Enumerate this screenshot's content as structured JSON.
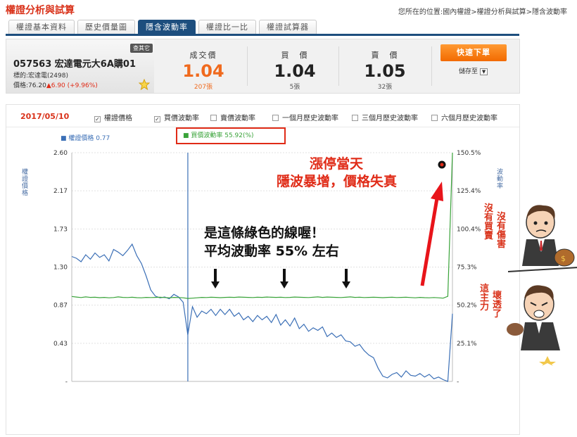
{
  "header": {
    "title": "權證分析與試算",
    "breadcrumb": "您所在的位置:國內權證>權證分析與試算>隱含波動率"
  },
  "tabs": [
    {
      "label": "權證基本資料",
      "active": false
    },
    {
      "label": "歷史價量圖",
      "active": false
    },
    {
      "label": "隱含波動率",
      "active": true
    },
    {
      "label": "權證比一比",
      "active": false
    },
    {
      "label": "權證試算器",
      "active": false
    }
  ],
  "quote": {
    "badge": "查其它",
    "code_name": "057563 宏達電元大6A購01",
    "underlying": "標的:宏達電(2498)",
    "price_prefix": "價格:76.20",
    "price_change": "▲6.90 (+9.96%)",
    "last": {
      "label": "成交價",
      "value": "1.04",
      "volume": "207張"
    },
    "bid": {
      "label": "買　價",
      "value": "1.04",
      "volume": "5張"
    },
    "ask": {
      "label": "賣　價",
      "value": "1.05",
      "volume": "32張"
    },
    "order_button": "快速下單",
    "save_label": "儲存至"
  },
  "toolbar": {
    "date": "2017/05/10",
    "options": [
      {
        "label": "權證價格",
        "checked": true
      },
      {
        "label": "買價波動率",
        "checked": true
      },
      {
        "label": "賣價波動率",
        "checked": false
      },
      {
        "label": "一個月歷史波動率",
        "checked": false
      },
      {
        "label": "三個月歷史波動率",
        "checked": false
      },
      {
        "label": "六個月歷史波動率",
        "checked": false
      }
    ]
  },
  "chart_labels": {
    "legend_price": "■ 權證價格 0.77",
    "legend_vol": "■ 買價波動率 55.92(%)",
    "y_left_title": "權證價格",
    "y_right_title": "波動率"
  },
  "annotations": {
    "spike_title": "漲停當天",
    "spike_sub": "隱波暴增，價格失真",
    "green_line_1": "是這條綠色的線喔！",
    "green_line_2": "平均波動率 55%  左右"
  },
  "cartoon": {
    "left_text_1": "沒有買賣",
    "right_text_1": "沒有傷害",
    "left_text_2": "這主力",
    "right_text_2": "壞透了"
  },
  "colors": {
    "brand_red": "#d9321a",
    "tab_active": "#1d4e7e",
    "price_line": "#3b6fb6",
    "vol_line": "#39a339",
    "last_price": "#f06a1e",
    "buy_button": "#f57d14"
  },
  "chart_data": {
    "type": "line",
    "y_left": {
      "ticks": [
        "2.60",
        "2.17",
        "1.73",
        "1.30",
        "0.87",
        "0.43",
        "-"
      ],
      "min": 0,
      "max": 2.6
    },
    "y_right": {
      "ticks": [
        "150.5%",
        "125.4%",
        "100.4%",
        "75.3%",
        "50.2%",
        "25.1%",
        "-"
      ],
      "min": 0,
      "max": 150.5
    },
    "series": [
      {
        "name": "權證價格",
        "axis": "left",
        "color": "#3b6fb6",
        "values": [
          1.42,
          1.4,
          1.36,
          1.44,
          1.39,
          1.46,
          1.41,
          1.44,
          1.37,
          1.5,
          1.47,
          1.43,
          1.49,
          1.56,
          1.43,
          1.34,
          1.2,
          1.04,
          0.97,
          0.95,
          0.96,
          0.94,
          0.99,
          0.96,
          0.9,
          0.53,
          0.85,
          0.73,
          0.8,
          0.77,
          0.82,
          0.75,
          0.82,
          0.76,
          0.82,
          0.74,
          0.78,
          0.7,
          0.74,
          0.68,
          0.75,
          0.7,
          0.74,
          0.67,
          0.76,
          0.64,
          0.7,
          0.63,
          0.72,
          0.6,
          0.65,
          0.57,
          0.61,
          0.58,
          0.62,
          0.51,
          0.55,
          0.5,
          0.53,
          0.46,
          0.45,
          0.4,
          0.42,
          0.35,
          0.3,
          0.27,
          0.15,
          0.06,
          0.04,
          0.08,
          0.1,
          0.05,
          0.12,
          0.07,
          0.06,
          0.09,
          0.05,
          0.08,
          0.03,
          0.05,
          0.02,
          0.0,
          0.77
        ]
      },
      {
        "name": "買價波動率",
        "axis": "right",
        "color": "#39a339",
        "values": [
          55.9,
          55.5,
          55.2,
          55.6,
          55.3,
          55.4,
          55.1,
          55.3,
          55.0,
          55.2,
          55.6,
          55.3,
          55.2,
          55.4,
          55.1,
          55.0,
          55.3,
          55.2,
          55.3,
          55.4,
          55.2,
          55.0,
          55.3,
          55.2,
          55.0,
          54.6,
          54.8,
          55.0,
          55.3,
          55.2,
          55.4,
          55.3,
          55.1,
          55.3,
          55.4,
          55.3,
          55.5,
          55.4,
          55.3,
          55.2,
          55.4,
          55.3,
          55.5,
          55.4,
          55.3,
          55.4,
          55.2,
          55.3,
          55.5,
          55.4,
          55.3,
          55.2,
          55.4,
          55.6,
          55.3,
          55.5,
          55.4,
          55.3,
          55.2,
          55.4,
          55.6,
          55.3,
          55.4,
          55.2,
          55.3,
          55.4,
          55.3,
          55.1,
          55.3,
          55.4,
          55.2,
          55.3,
          55.4,
          55.2,
          55.0,
          55.3,
          55.1,
          55.0,
          55.2,
          55.0,
          54.8,
          56.0,
          150.5
        ]
      }
    ],
    "markers": [
      "current_date_line",
      "spike_dot"
    ]
  }
}
